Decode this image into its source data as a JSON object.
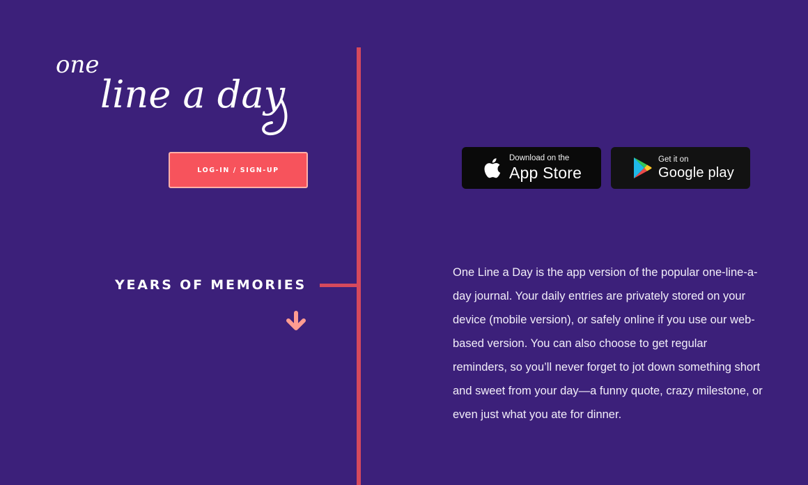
{
  "brand": {
    "logo_text": "one line a day"
  },
  "auth": {
    "login_label": "LOG-IN / SIGN-UP"
  },
  "section": {
    "heading": "YEARS OF MEMORIES",
    "scroll_icon": "arrow-down-icon"
  },
  "downloads": {
    "app_store": {
      "small_text": "Download on the",
      "large_text": "App Store",
      "icon": "apple-icon"
    },
    "google_play": {
      "small_text": "Get it on",
      "large_text": "Google play",
      "icon": "google-play-icon"
    }
  },
  "description": "One Line a Day is the app version of the popular one-line-a-day journal. Your daily entries are privately stored on your device (mobile version), or safely online if you use our web-based version. You can also choose to get regular reminders, so you’ll never forget to jot down something short and sweet from your day—a funny quote, crazy milestone, or even just what you ate for dinner.",
  "colors": {
    "background": "#3c207a",
    "accent": "#f7535c",
    "timeline": "#d6495c",
    "arrow": "#ff9c91"
  }
}
